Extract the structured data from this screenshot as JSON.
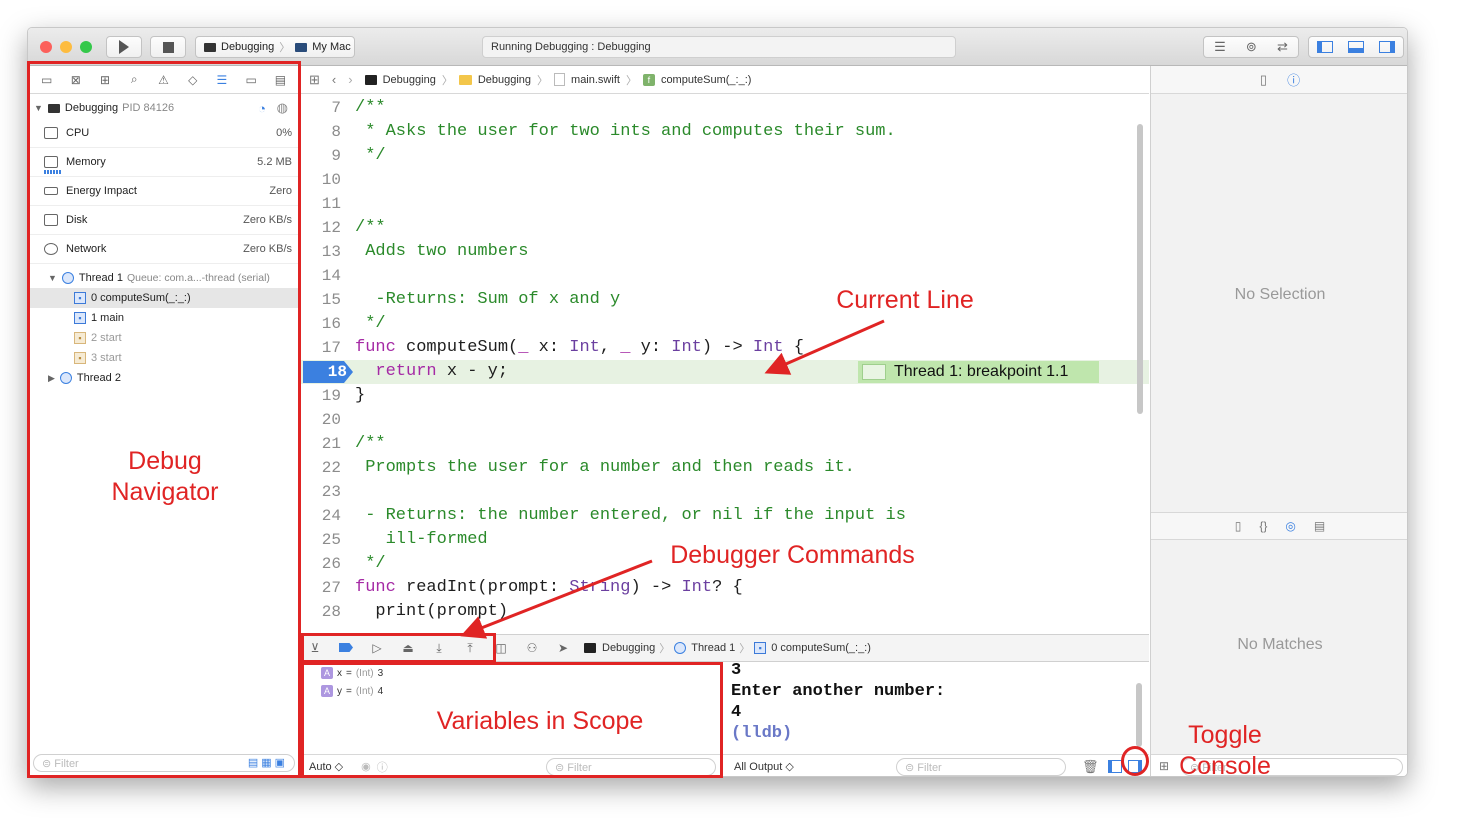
{
  "toolbar": {
    "run_icon": "play-icon",
    "stop_icon": "stop-icon",
    "scheme": "Debugging",
    "destination": "My Mac",
    "activity_status": "Running Debugging : Debugging"
  },
  "navigator": {
    "process_name": "Debugging",
    "process_pid": "PID 84126",
    "gauges": [
      {
        "label": "CPU",
        "value": "0%"
      },
      {
        "label": "Memory",
        "value": "5.2 MB"
      },
      {
        "label": "Energy Impact",
        "value": "Zero"
      },
      {
        "label": "Disk",
        "value": "Zero KB/s"
      },
      {
        "label": "Network",
        "value": "Zero KB/s"
      }
    ],
    "thread1": {
      "label": "Thread 1",
      "queue": "Queue: com.a...-thread (serial)"
    },
    "frames": [
      "0 computeSum(_:_:)",
      "1 main",
      "2 start",
      "3 start"
    ],
    "thread2": "Thread 2",
    "filter_placeholder": "Filter"
  },
  "jumpbar": {
    "crumbs": [
      "Debugging",
      "Debugging",
      "main.swift",
      "computeSum(_:_:)"
    ]
  },
  "editor": {
    "lines": [
      {
        "n": "7",
        "segments": [
          {
            "t": "/**",
            "c": "cm"
          }
        ]
      },
      {
        "n": "8",
        "segments": [
          {
            "t": " * Asks the user for two ints and computes their sum.",
            "c": "cm"
          }
        ]
      },
      {
        "n": "9",
        "segments": [
          {
            "t": " */",
            "c": "cm"
          }
        ]
      },
      {
        "n": "10",
        "segments": []
      },
      {
        "n": "11",
        "segments": []
      },
      {
        "n": "12",
        "segments": [
          {
            "t": "/**",
            "c": "cm"
          }
        ]
      },
      {
        "n": "13",
        "segments": [
          {
            "t": " Adds two numbers",
            "c": "cm"
          }
        ]
      },
      {
        "n": "14",
        "segments": []
      },
      {
        "n": "15",
        "segments": [
          {
            "t": "  -Returns: Sum of x and y",
            "c": "cm"
          }
        ]
      },
      {
        "n": "16",
        "segments": [
          {
            "t": " */",
            "c": "cm"
          }
        ]
      },
      {
        "n": "17",
        "segments": [
          {
            "t": "func",
            "c": "kw"
          },
          {
            "t": " computeSum(",
            "c": ""
          },
          {
            "t": "_",
            "c": "kw"
          },
          {
            "t": " x: ",
            "c": ""
          },
          {
            "t": "Int",
            "c": "ty"
          },
          {
            "t": ", ",
            "c": ""
          },
          {
            "t": "_",
            "c": "kw"
          },
          {
            "t": " y: ",
            "c": ""
          },
          {
            "t": "Int",
            "c": "ty"
          },
          {
            "t": ") -> ",
            "c": ""
          },
          {
            "t": "Int",
            "c": "ty"
          },
          {
            "t": " {",
            "c": ""
          }
        ]
      },
      {
        "n": "18",
        "segments": [
          {
            "t": "  ",
            "c": ""
          },
          {
            "t": "return",
            "c": "kw"
          },
          {
            "t": " x - y;",
            "c": ""
          }
        ],
        "current": true
      },
      {
        "n": "19",
        "segments": [
          {
            "t": "}",
            "c": ""
          }
        ]
      },
      {
        "n": "20",
        "segments": []
      },
      {
        "n": "21",
        "segments": [
          {
            "t": "/**",
            "c": "cm"
          }
        ]
      },
      {
        "n": "22",
        "segments": [
          {
            "t": " Prompts the user for a number and then reads it.",
            "c": "cm"
          }
        ]
      },
      {
        "n": "23",
        "segments": []
      },
      {
        "n": "24",
        "segments": [
          {
            "t": " - Returns: the number entered, or nil if the input is",
            "c": "cm"
          }
        ]
      },
      {
        "n": "25",
        "segments": [
          {
            "t": "   ill-formed",
            "c": "cm"
          }
        ]
      },
      {
        "n": "26",
        "segments": [
          {
            "t": " */",
            "c": "cm"
          }
        ]
      },
      {
        "n": "27",
        "segments": [
          {
            "t": "func",
            "c": "kw"
          },
          {
            "t": " readInt(prompt: ",
            "c": ""
          },
          {
            "t": "String",
            "c": "ty"
          },
          {
            "t": ") -> ",
            "c": ""
          },
          {
            "t": "Int",
            "c": "ty"
          },
          {
            "t": "? {",
            "c": ""
          }
        ]
      },
      {
        "n": "28",
        "segments": [
          {
            "t": "  print(prompt)",
            "c": ""
          }
        ]
      }
    ],
    "breakpoint_label": "Thread 1: breakpoint 1.1"
  },
  "debugbar": {
    "crumbs": [
      "Debugging",
      "Thread 1",
      "0 computeSum(_:_:)"
    ]
  },
  "variables": [
    {
      "name": "x",
      "type": "(Int)",
      "value": "3"
    },
    {
      "name": "y",
      "type": "(Int)",
      "value": "4"
    }
  ],
  "variables_footer": {
    "scope": "Auto ◇",
    "filter_placeholder": "Filter"
  },
  "console": {
    "lines": [
      "3",
      "Enter another number:",
      "4",
      "(lldb)"
    ],
    "output_mode": "All Output ◇",
    "filter_placeholder": "Filter"
  },
  "inspector": {
    "no_selection": "No Selection",
    "no_matches": "No Matches",
    "filter_placeholder": "Filter"
  },
  "annotations": {
    "debug_navigator": "Debug\nNavigator",
    "current_line": "Current Line",
    "debugger_commands": "Debugger Commands",
    "variables_in_scope": "Variables in Scope",
    "toggle_console": "Toggle Console",
    "color": "#e02424"
  },
  "colors": {
    "accent": "#3b80e0",
    "breakpoint_highlight": "#bfe6ad",
    "comment": "#2b8a2b",
    "keyword": "#a52aa5"
  }
}
